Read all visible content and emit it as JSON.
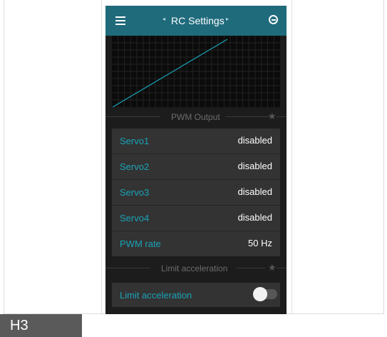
{
  "appbar": {
    "title": "RC Settings",
    "nav_prev": "◂",
    "nav_next": "▸",
    "menu_icon": "hamburger-menu-icon",
    "exit_icon": "exit-circle-icon",
    "color": "#1f6b7c"
  },
  "chart_data": {
    "type": "line",
    "x": [
      0,
      1
    ],
    "y": [
      0,
      1
    ],
    "color": "#1aa3b8",
    "grid": true
  },
  "pwm_section": {
    "title": "PWM Output",
    "rows": [
      {
        "label": "Servo1",
        "value": "disabled"
      },
      {
        "label": "Servo2",
        "value": "disabled"
      },
      {
        "label": "Servo3",
        "value": "disabled"
      },
      {
        "label": "Servo4",
        "value": "disabled"
      },
      {
        "label": "PWM rate",
        "value": "50 Hz"
      }
    ]
  },
  "accel_section": {
    "title": "Limit acceleration",
    "toggle_label": "Limit acceleration",
    "toggle_on": false
  },
  "footer_tag": "H3",
  "colors": {
    "accent": "#1aa3b8",
    "background": "#1c1c1c",
    "card": "#333333"
  }
}
